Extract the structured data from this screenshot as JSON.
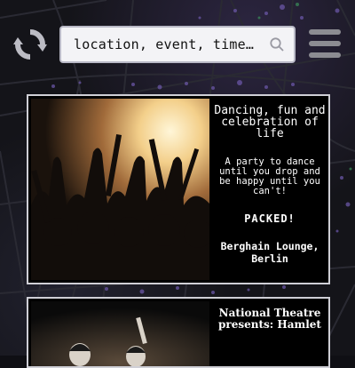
{
  "search": {
    "placeholder": "location, event, time…"
  },
  "events": [
    {
      "title": "Dancing, fun and celebration of life",
      "description": "A party to dance until you drop and be happy until you can't!",
      "status": "PACKED!",
      "venue": "Berghain Lounge, Berlin"
    },
    {
      "title": "National Theatre presents: Hamlet"
    }
  ],
  "icons": {
    "refresh": "refresh-icon",
    "search": "magnifier-icon",
    "menu": "hamburger-menu-icon"
  },
  "colors": {
    "card_border": "#cfcfd6",
    "search_bg": "#f3f3f6",
    "accent_bokeh": "#7a5ab8"
  }
}
